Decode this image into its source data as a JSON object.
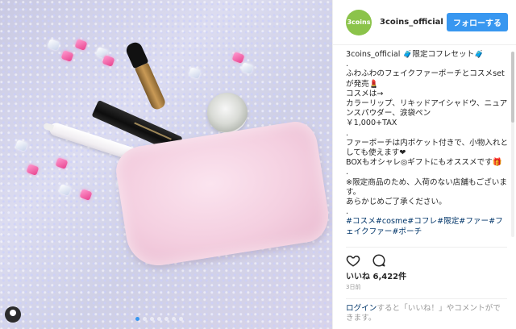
{
  "post": {
    "account_name": "3coins_official",
    "logo_text": "3coins",
    "follow_label": "フォローする",
    "caption_lines": [
      "3coins_official 🧳限定コフレセット🧳",
      ".",
      "ふわふわのフェイクファーポーチとコスメsetが発売💄",
      "コスメは→",
      "カラーリップ、リキッドアイシャドウ、ニュアンスパウダー、涙袋ペン",
      "￥1,000+TAX",
      ".",
      "ファーポーチは内ポケット付きで、小物入れとしても使えます❤",
      "BOXもオシャレ◎ギフトにもオススメです🎁",
      ".",
      "※限定商品のため、入荷のない店舗もございます。",
      "あらかじめご了承ください。",
      ".",
      "#コスメ#cosme#コフレ#限定#ファー#フェイクファー#ポーチ"
    ],
    "likes_label": "いいね",
    "likes_count": "6,422件",
    "timestamp": "3日前",
    "login_link": "ログイン",
    "login_text": "すると「いいね！」やコメントができます。"
  },
  "icons": {
    "heart": "heart-icon",
    "comment": "comment-icon",
    "user": "user-icon"
  },
  "colors": {
    "follow": "#3897f0",
    "logo": "#8bc34a",
    "hashtags": "#003569"
  }
}
